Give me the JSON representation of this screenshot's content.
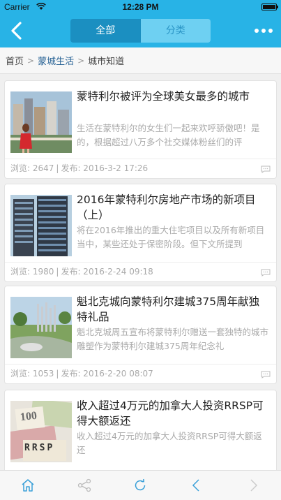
{
  "status_bar": {
    "carrier": "Carrier",
    "time": "12:28 PM"
  },
  "nav": {
    "tabs": [
      {
        "label": "全部",
        "active": true
      },
      {
        "label": "分类",
        "active": false
      }
    ],
    "back_icon": "chevron-left-icon",
    "more_icon": "ellipsis-icon"
  },
  "breadcrumb": [
    "首页",
    "蒙城生活",
    "城市知道"
  ],
  "articles": [
    {
      "title": "蒙特利尔被评为全球美女最多的城市",
      "summary": "生活在蒙特利尔的女生们一起来欢呼骄傲吧！是的，根据超过八万多个社交媒体粉丝们的评",
      "views_label": "浏览: 2647",
      "date_label": "发布: 2016-3-2 17:26"
    },
    {
      "title": "2016年蒙特利尔房地产市场的新项目（上）",
      "summary": "将在2016年推出的重大住宅项目以及所有新项目当中，某些还处于保密阶段。但下文所提到",
      "views_label": "浏览: 1980",
      "date_label": "发布: 2016-2-24 09:18"
    },
    {
      "title": "魁北克城向蒙特利尔建城375周年献独特礼品",
      "summary": "魁北克城周五宣布将蒙特利尔赠送一套独特的城市雕塑作为蒙特利尔建城375周年纪念礼",
      "views_label": "浏览: 1053",
      "date_label": "发布: 2016-2-20 08:07"
    },
    {
      "title": "收入超过4万元的加拿大人投资RRSP可得大额返还",
      "summary": "收入超过4万元的加拿大人投资RRSP可得大额返还",
      "image_text": [
        "100",
        "RRSP"
      ]
    }
  ],
  "colors": {
    "nav_bg": "#28b3e6",
    "active_tab": "#1b8fc1",
    "inactive_tab": "#6ed0f2",
    "link": "#2a6496"
  },
  "toolbar_icons": [
    "home-icon",
    "share-icon",
    "refresh-icon",
    "back-arrow-icon",
    "forward-arrow-icon"
  ]
}
